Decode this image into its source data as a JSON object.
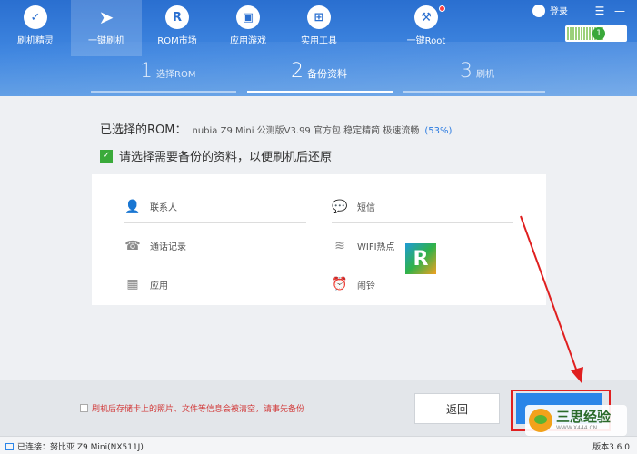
{
  "nav": {
    "items": [
      {
        "label": "刷机精灵",
        "icon": "shield-icon"
      },
      {
        "label": "一键刷机",
        "icon": "cursor-icon"
      },
      {
        "label": "ROM市场",
        "icon": "r-icon"
      },
      {
        "label": "应用游戏",
        "icon": "shop-icon"
      },
      {
        "label": "实用工具",
        "icon": "grid-icon"
      }
    ],
    "root": {
      "label": "一键Root",
      "icon": "toolbox-icon"
    }
  },
  "topright": {
    "login": "登录",
    "menu": "☰",
    "minimize": "—",
    "signal_count": "1"
  },
  "steps": [
    {
      "num": "1",
      "text": "选择ROM"
    },
    {
      "num": "2",
      "text": "备份资料"
    },
    {
      "num": "3",
      "text": "刷机"
    }
  ],
  "rom": {
    "label": "已选择的ROM：",
    "value": "nubia Z9 Mini 公测版V3.99 官方包 稳定精简 极速流畅",
    "percent": "(53%)"
  },
  "backup_prompt": "请选择需要备份的资料，以便刷机后还原",
  "backup_items": {
    "contacts": "联系人",
    "sms": "短信",
    "calls": "通话记录",
    "wifi": "WIFI热点",
    "apps": "应用",
    "alarm": "闹铃"
  },
  "warning": "刷机后存储卡上的照片、文件等信息会被清空，请事先备份",
  "buttons": {
    "back": "返回"
  },
  "watermark": {
    "title": "三思经验",
    "url": "WWW.X444.CN"
  },
  "status": {
    "connected": "已连接：努比亚 Z9 Mini(NX511J)",
    "version": "版本3.6.0"
  },
  "colors": {
    "header": "#3f86e0",
    "accent": "#2a85e8",
    "warning": "#d23a3a",
    "highlight": "#e02020",
    "check": "#3aaa3a"
  }
}
